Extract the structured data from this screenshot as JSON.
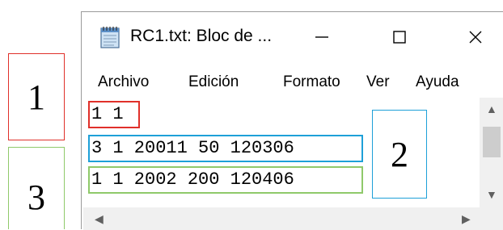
{
  "callouts": {
    "one": "1",
    "two": "2",
    "three": "3"
  },
  "window": {
    "title": "RC1.txt: Bloc de ...",
    "icon": "notepad-icon",
    "controls": {
      "minimize": "—",
      "maximize": "☐",
      "close": "✕"
    }
  },
  "menu": {
    "items": [
      "Archivo",
      "Edición",
      "Formato",
      "Ver",
      "Ayuda"
    ]
  },
  "editor": {
    "lines": [
      "1 1",
      "3 1 20011 50 120306",
      "1 1 2002 200 120406"
    ]
  },
  "colors": {
    "callout_1": "#e0302a",
    "callout_2": "#1ea0d8",
    "callout_3": "#8fc96a"
  }
}
